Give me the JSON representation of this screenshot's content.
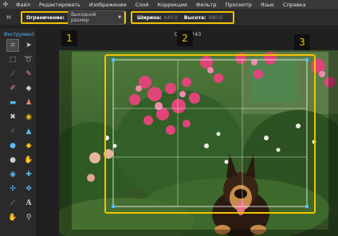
{
  "menu": [
    "Файл",
    "Редактировать",
    "Изображение",
    "Слой",
    "Коррекция",
    "Фильтр",
    "Просмотр",
    "Язык",
    "Справка"
  ],
  "options": {
    "constraint_label": "Ограничение:",
    "constraint_value": "Выходной размер",
    "width_label": "Ширина:",
    "width_value": "640.0",
    "height_label": "Высота:",
    "height_value": "480.0"
  },
  "toolpanel": {
    "title": "Инструмент"
  },
  "document": {
    "title": "CIMG0743"
  },
  "annotations": [
    "1",
    "2",
    "3"
  ],
  "colors": {
    "highlight": "#f2c200",
    "accent": "#59b8f0"
  },
  "tools": [
    "crop-icon",
    "move-icon",
    "marquee-icon",
    "lasso-icon",
    "wand-icon",
    "pencil-icon",
    "brush-icon",
    "clone-icon",
    "eraser-icon",
    "bucket-icon",
    "gradient-icon",
    "stamp-icon",
    "smudge-icon",
    "sharpen-icon",
    "blur-icon",
    "dodge-icon",
    "burn-icon",
    "sponge-icon",
    "eyedropper-icon",
    "red-eye-icon",
    "spot-heal-icon",
    "bloat-icon",
    "pinch-icon",
    "hand-icon",
    "text-icon",
    "zoom-icon"
  ]
}
